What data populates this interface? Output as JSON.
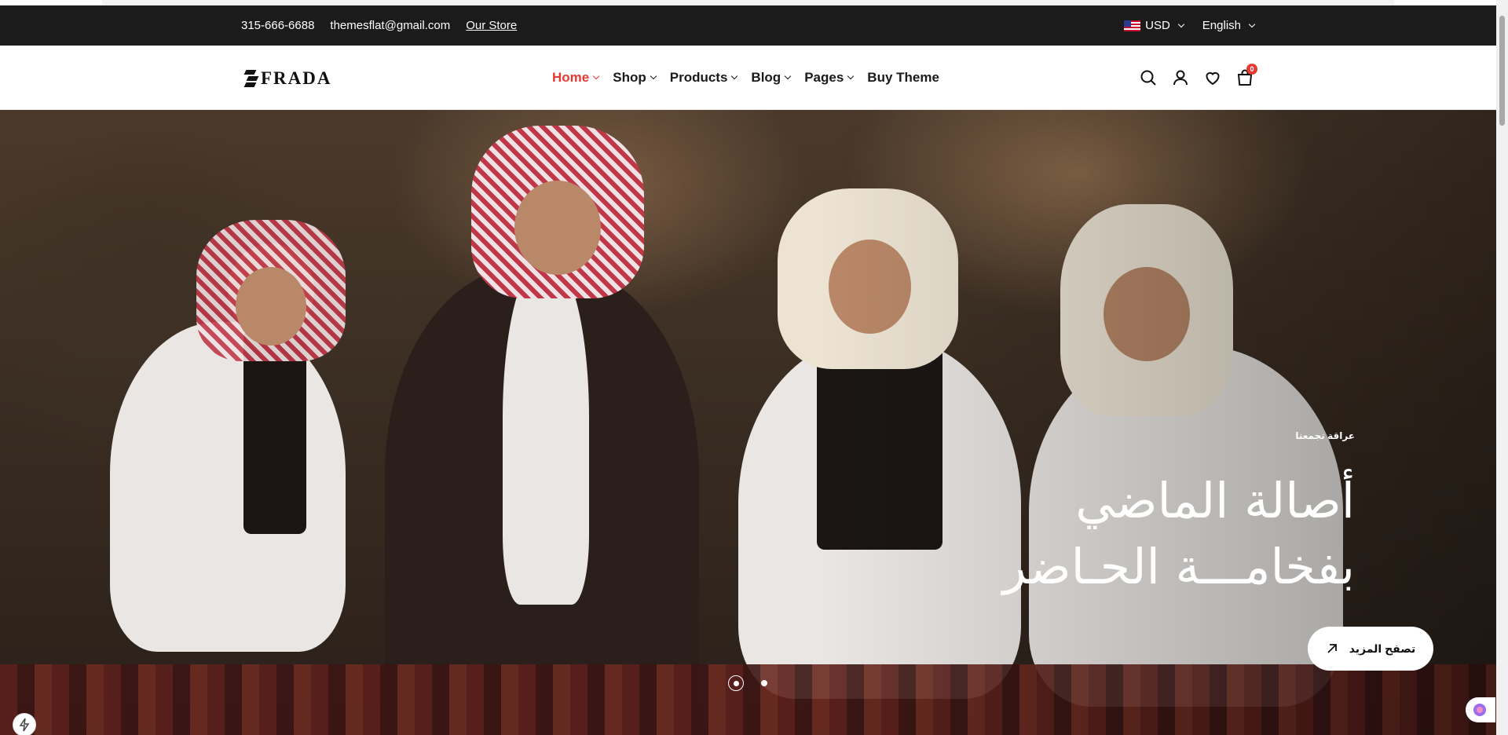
{
  "topbar": {
    "phone": "315-666-6688",
    "email": "themesflat@gmail.com",
    "store_link": "Our Store",
    "currency": "USD",
    "language": "English"
  },
  "header": {
    "logo": "FRADA",
    "nav": [
      {
        "label": "Home",
        "active": true
      },
      {
        "label": "Shop"
      },
      {
        "label": "Products"
      },
      {
        "label": "Blog"
      },
      {
        "label": "Pages"
      },
      {
        "label": "Buy Theme"
      }
    ],
    "cart_count": "0"
  },
  "hero": {
    "subtitle": "عراقة تجمعنا",
    "title_line1": "أصالة الماضي",
    "title_line2": "بفخامـــة الحـاضر",
    "cta": "تصفح المزيد"
  },
  "colors": {
    "accent": "#e53a32",
    "topbar_bg": "#1b1b1b"
  },
  "icons": [
    "search-icon",
    "user-icon",
    "heart-icon",
    "cart-icon",
    "arrow-up-right-icon"
  ]
}
